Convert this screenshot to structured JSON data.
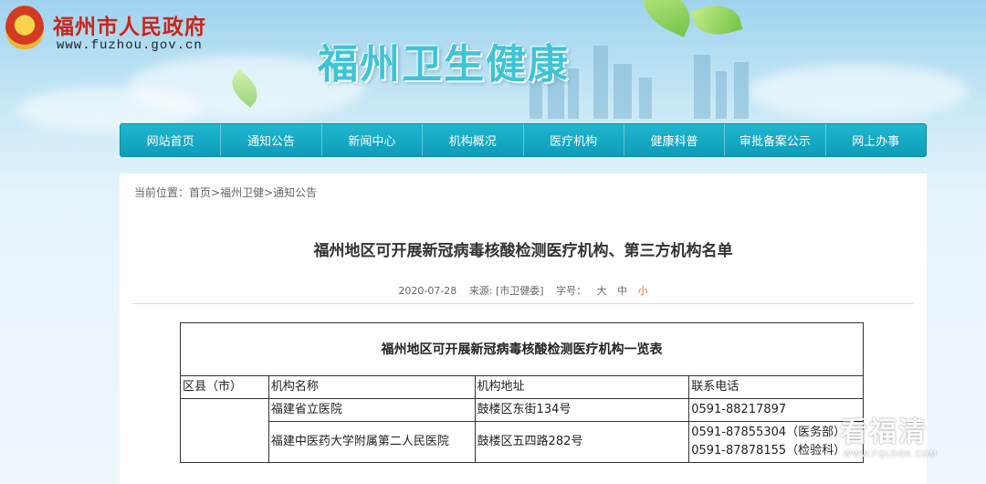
{
  "header": {
    "gov_title": "福州市人民政府",
    "gov_url": "www.fuzhou.gov.cn",
    "site_title": "福州卫生健康"
  },
  "nav": {
    "items": [
      {
        "label": "网站首页"
      },
      {
        "label": "通知公告"
      },
      {
        "label": "新闻中心"
      },
      {
        "label": "机构概况"
      },
      {
        "label": "医疗机构"
      },
      {
        "label": "健康科普"
      },
      {
        "label": "审批备案公示"
      },
      {
        "label": "网上办事"
      }
    ]
  },
  "breadcrumb": {
    "prefix": "当前位置：",
    "items": [
      "首页",
      "福州卫健",
      "通知公告"
    ],
    "separator": ">"
  },
  "article": {
    "title": "福州地区可开展新冠病毒核酸检测医疗机构、第三方机构名单",
    "date": "2020-07-28",
    "source": "来源: [市卫健委]",
    "font_size_label": "字号：",
    "size_large": "大",
    "size_medium": "中",
    "size_small": "小"
  },
  "table": {
    "caption": "福州地区可开展新冠病毒核酸检测医疗机构一览表",
    "headers": [
      "区县（市）",
      "机构名称",
      "机构地址",
      "联系电话"
    ],
    "rows": [
      {
        "district": "",
        "name": "福建省立医院",
        "address": "鼓楼区东街134号",
        "phones": [
          "0591-88217897"
        ]
      },
      {
        "district": "",
        "name": "福建中医药大学附属第二人民医院",
        "address": "鼓楼区五四路282号",
        "phones": [
          "0591-87855304（医务部）",
          "0591-87878155（检验科）"
        ]
      }
    ]
  },
  "watermark": {
    "main": "看福清",
    "sub": "WWW.FQLOOK.COM"
  },
  "colors": {
    "nav_bg": "#0e9cb8",
    "gov_title": "#c8261b",
    "site_title": "#3ec4d6",
    "small_size": "#e0701f"
  }
}
